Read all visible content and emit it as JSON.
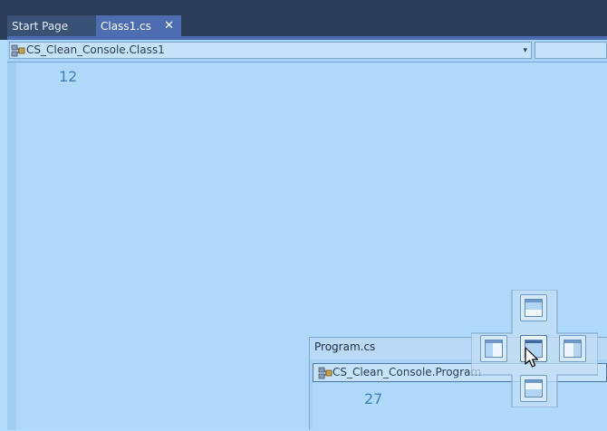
{
  "tabs": [
    {
      "label": "Start Page",
      "active": false
    },
    {
      "label": "Class1.cs",
      "active": true,
      "close_glyph": "✕"
    }
  ],
  "editor": {
    "nav_type": "CS_Clean_Console.Class1",
    "dropdown_glyph": "▾",
    "line_number": "12"
  },
  "floating_window": {
    "title": "Program.cs",
    "nav_type": "CS_Clean_Console.Program",
    "line_number": "27"
  },
  "dock_guide": {
    "buttons": [
      "dock-top",
      "dock-left",
      "dock-center",
      "dock-right",
      "dock-bottom"
    ]
  },
  "colors": {
    "tab_strip": "#2b3c59",
    "active_tab": "#4d6db0",
    "editor_bg": "#b0d8fb",
    "line_number": "#3b7fc4"
  }
}
